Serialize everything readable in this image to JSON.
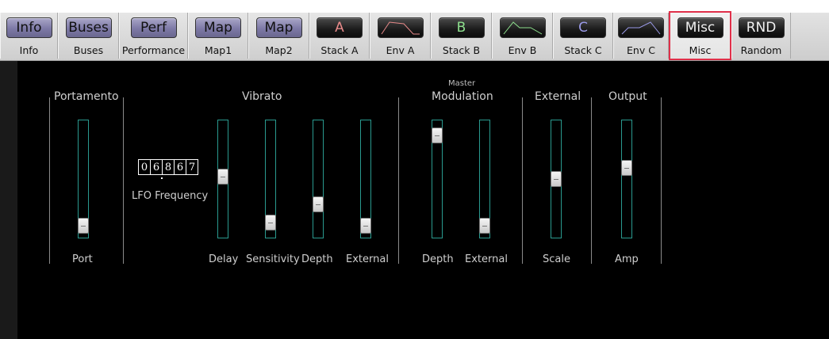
{
  "tabs": [
    {
      "id": "info",
      "button": "Info",
      "label": "Info",
      "style": "purple"
    },
    {
      "id": "buses",
      "button": "Buses",
      "label": "Buses",
      "style": "purple"
    },
    {
      "id": "perf",
      "button": "Perf",
      "label": "Performance",
      "style": "purple"
    },
    {
      "id": "map1",
      "button": "Map",
      "label": "Map1",
      "style": "purple"
    },
    {
      "id": "map2",
      "button": "Map",
      "label": "Map2",
      "style": "purple"
    },
    {
      "id": "stack-a",
      "button": "A",
      "label": "Stack A",
      "style": "dark",
      "button_color": "#e88a8a"
    },
    {
      "id": "env-a",
      "button": "",
      "label": "Env A",
      "style": "dark",
      "env_color": "#e88a8a"
    },
    {
      "id": "stack-b",
      "button": "B",
      "label": "Stack B",
      "style": "dark",
      "button_color": "#8ee08e"
    },
    {
      "id": "env-b",
      "button": "",
      "label": "Env B",
      "style": "dark",
      "env_color": "#8ee08e"
    },
    {
      "id": "stack-c",
      "button": "C",
      "label": "Stack C",
      "style": "dark",
      "button_color": "#9a9ae8"
    },
    {
      "id": "env-c",
      "button": "",
      "label": "Env C",
      "style": "dark",
      "env_color": "#9a9ae8"
    },
    {
      "id": "misc",
      "button": "Misc",
      "label": "Misc",
      "style": "dark",
      "active": true
    },
    {
      "id": "random",
      "button": "RND",
      "label": "Random",
      "style": "dark"
    }
  ],
  "sections": {
    "portamento": "Portamento",
    "vibrato": "Vibrato",
    "modulation_master": "Master",
    "modulation": "Modulation",
    "external": "External",
    "output": "Output"
  },
  "lfo": {
    "digits": [
      "0",
      "6",
      "8",
      "6",
      "7"
    ],
    "label": "LFO Frequency"
  },
  "sliders": [
    {
      "id": "port",
      "label": "Port",
      "level": 0.04
    },
    {
      "id": "vib-delay",
      "label": "Delay",
      "level": 0.52
    },
    {
      "id": "vib-sensitivity",
      "label": "Sensitivity",
      "level": 0.07
    },
    {
      "id": "vib-depth",
      "label": "Depth",
      "level": 0.25
    },
    {
      "id": "vib-external",
      "label": "External",
      "level": 0.04
    },
    {
      "id": "mod-depth",
      "label": "Depth",
      "level": 0.93
    },
    {
      "id": "mod-external",
      "label": "External",
      "level": 0.04
    },
    {
      "id": "ext-scale",
      "label": "Scale",
      "level": 0.5
    },
    {
      "id": "out-amp",
      "label": "Amp",
      "level": 0.61
    }
  ],
  "colors": {
    "accent_active_tab": "#e0304a",
    "slider_track": "#2a9a8f"
  }
}
